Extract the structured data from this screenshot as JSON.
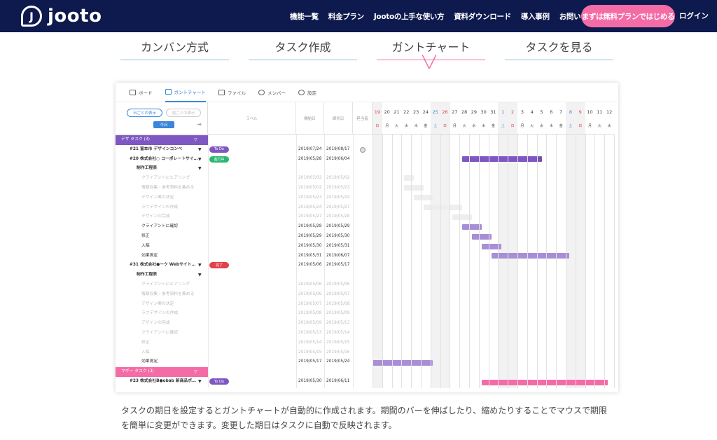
{
  "header": {
    "logo_text": "jooto",
    "nav": [
      "機能一覧",
      "料金プラン",
      "Jootoの上手な使い方",
      "資料ダウンロード",
      "導入事例",
      "お問い合わせ"
    ],
    "cta_label": "まずは無料プランではじめる",
    "login_label": "ログイン"
  },
  "feature_tabs": [
    "カンバン方式",
    "タスク作成",
    "ガントチャート",
    "タスクを見る"
  ],
  "app": {
    "tabs": [
      "ボード",
      "ガントチャート",
      "ファイル",
      "メンバー",
      "設定"
    ],
    "view_day": "日ごとの表示",
    "view_week": "週ごとの表示",
    "today": "今日",
    "columns": {
      "label": "ラベル",
      "start": "開始日",
      "end": "締切日",
      "owner": "担当者"
    },
    "days": [
      "19",
      "20",
      "21",
      "22",
      "23",
      "24",
      "25",
      "26",
      "27",
      "28",
      "29",
      "30",
      "31",
      "1",
      "2",
      "3",
      "4",
      "5",
      "6",
      "7",
      "8",
      "9",
      "10",
      "11",
      "12"
    ],
    "weekdays": [
      "日",
      "月",
      "火",
      "水",
      "木",
      "金",
      "土",
      "日",
      "月",
      "火",
      "水",
      "木",
      "金",
      "土",
      "日",
      "月",
      "火",
      "水",
      "木",
      "金",
      "土",
      "日",
      "月",
      "火",
      "水"
    ],
    "rows": [
      {
        "name": "デザ タスク (3)",
        "type": "group"
      },
      {
        "name": "#21 富本市 デザインコンペ",
        "label": "To Do",
        "start": "2019/07/24",
        "end": "2019/08/17"
      },
      {
        "name": "#20 株式会社○ コーポレートサイ…",
        "label": "進行中",
        "start": "2019/05/28",
        "end": "2019/06/04"
      },
      {
        "name": "制作工程表",
        "start": "",
        "end": ""
      },
      {
        "name": "クライアントにヒアリング",
        "start": "2019/05/02",
        "end": "2019/05/02",
        "faded": true
      },
      {
        "name": "情報収集・参考資料を集める",
        "start": "2019/05/02",
        "end": "2019/05/23",
        "faded": true
      },
      {
        "name": "デザイン案の決定",
        "start": "2019/05/23",
        "end": "2019/05/24",
        "faded": true
      },
      {
        "name": "ラフデザインの作成",
        "start": "2019/05/24",
        "end": "2019/05/27",
        "faded": true
      },
      {
        "name": "デザインの完成",
        "start": "2019/05/27",
        "end": "2019/05/28",
        "faded": true
      },
      {
        "name": "クライアントに確認",
        "start": "2019/05/28",
        "end": "2019/05/29"
      },
      {
        "name": "修正",
        "start": "2019/05/29",
        "end": "2019/05/30"
      },
      {
        "name": "入稿",
        "start": "2019/05/30",
        "end": "2019/05/31"
      },
      {
        "name": "効果測定",
        "start": "2019/05/31",
        "end": "2019/06/07"
      },
      {
        "name": "#31 株式会社●ーク Webサイト…",
        "label": "完了",
        "start": "2019/05/06",
        "end": "2019/05/17"
      },
      {
        "name": "制作工程表",
        "start": "",
        "end": ""
      },
      {
        "name": "クライアントにヒアリング",
        "start": "2019/05/06",
        "end": "2019/05/06",
        "faded": true
      },
      {
        "name": "情報収集・参考資料を集める",
        "start": "2019/05/06",
        "end": "2019/05/07",
        "faded": true
      },
      {
        "name": "デザイン案の決定",
        "start": "2019/05/07",
        "end": "2019/05/08",
        "faded": true
      },
      {
        "name": "ラフデザインの作成",
        "start": "2019/05/08",
        "end": "2019/05/09",
        "faded": true
      },
      {
        "name": "デザインの完成",
        "start": "2019/05/09",
        "end": "2019/05/13",
        "faded": true
      },
      {
        "name": "クライアントに確認",
        "start": "2019/05/13",
        "end": "2019/05/14",
        "faded": true
      },
      {
        "name": "修正",
        "start": "2019/05/14",
        "end": "2019/05/15",
        "faded": true
      },
      {
        "name": "入稿",
        "start": "2019/05/15",
        "end": "2019/05/16",
        "faded": true
      },
      {
        "name": "効果測定",
        "start": "2019/05/17",
        "end": "2019/05/24"
      },
      {
        "name": "マギー タスク (3)",
        "type": "group",
        "pink": true
      },
      {
        "name": "#23 株式会社B●obab 新商品ポ…",
        "label": "To Do",
        "start": "2019/05/30",
        "end": "2019/06/11"
      }
    ]
  },
  "description": "タスクの期日を設定するとガントチャートが自動的に作成されます。期間のバーを伸ばしたり、縮めたりすることでマウスで期限を簡単に変更ができます。変更した期日はタスクに自動で反映されます。",
  "colors": {
    "navy": "#0e1a4d",
    "pink": "#f46ca6",
    "purple": "#7e57c2",
    "blue": "#3b86d9"
  }
}
